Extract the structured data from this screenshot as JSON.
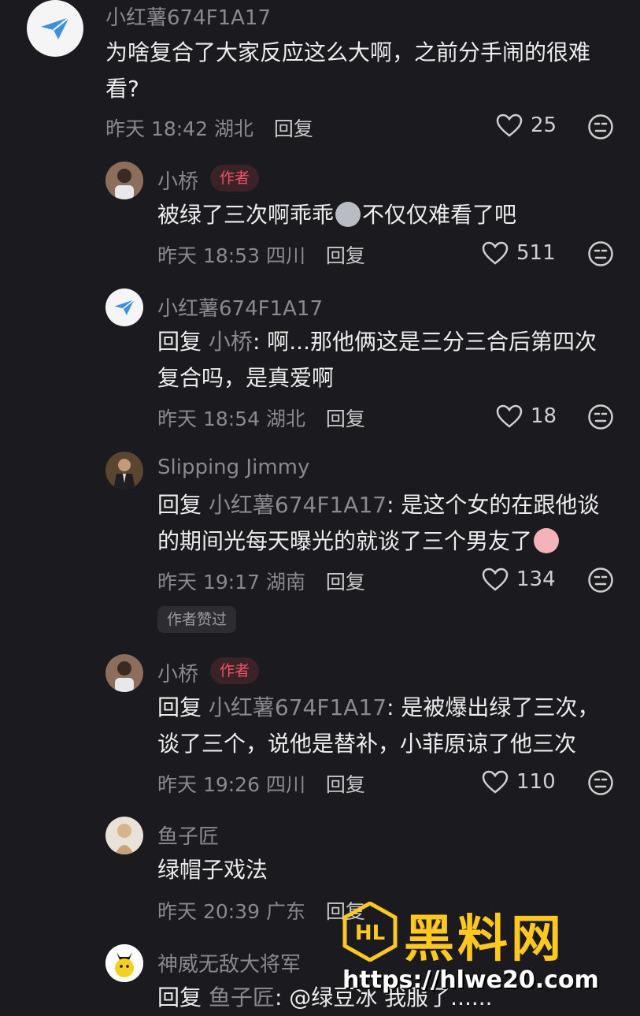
{
  "comments": [
    {
      "name": "小红薯674F1A17",
      "text_lines": [
        "为啥复合了大家反应这么大啊，之前分手闹的很难",
        "看?"
      ],
      "time": "昨天 18:42",
      "location": "湖北",
      "reply_label": "回复",
      "likes": "25",
      "avatar_icon": "paper-plane-icon"
    },
    {
      "name": "小桥",
      "author_tag": "作者",
      "text_before_emoji": "被绿了三次啊乖乖",
      "text_after_emoji": "不仅仅难看了吧",
      "time": "昨天 18:53",
      "location": "四川",
      "reply_label": "回复",
      "likes": "511"
    },
    {
      "name": "小红薯674F1A17",
      "reply_prefix": "回复",
      "reply_to": "小桥",
      "text_lines": [
        ": 啊...那他俩这是三分三合后第四次",
        "复合吗，是真爱啊"
      ],
      "time": "昨天 18:54",
      "location": "湖北",
      "reply_label": "回复",
      "likes": "18",
      "avatar_icon": "paper-plane-icon"
    },
    {
      "name": "Slipping Jimmy",
      "reply_prefix": "回复",
      "reply_to": "小红薯674F1A17",
      "text_lines": [
        ": 是这个女的在跟他谈",
        "的期间光每天曝光的就谈了三个男友了"
      ],
      "time": "昨天 19:17",
      "location": "湖南",
      "reply_label": "回复",
      "likes": "134",
      "liked_badge": "作者赞过"
    },
    {
      "name": "小桥",
      "author_tag": "作者",
      "reply_prefix": "回复",
      "reply_to": "小红薯674F1A17",
      "text_lines": [
        ": 是被爆出绿了三次，",
        "谈了三个，说他是替补，小菲原谅了他三次"
      ],
      "time": "昨天 19:26",
      "location": "四川",
      "reply_label": "回复",
      "likes": "110"
    },
    {
      "name": "鱼子匠",
      "text_lines": [
        "绿帽子戏法"
      ],
      "time": "昨天 20:39",
      "location": "广东",
      "reply_label": "回复"
    },
    {
      "name": "神威无敌大将军",
      "reply_prefix": "回复",
      "reply_to": "鱼子匠",
      "text_lines": [
        ": @绿豆冰 我服了......"
      ]
    }
  ],
  "watermark": {
    "title": "黑料网",
    "url": "https://hlwe20.com",
    "logo_text": "HL"
  },
  "colors": {
    "background": "#1b1b1f",
    "author_tag": "#f0556a",
    "watermark": "#ffc81f"
  }
}
